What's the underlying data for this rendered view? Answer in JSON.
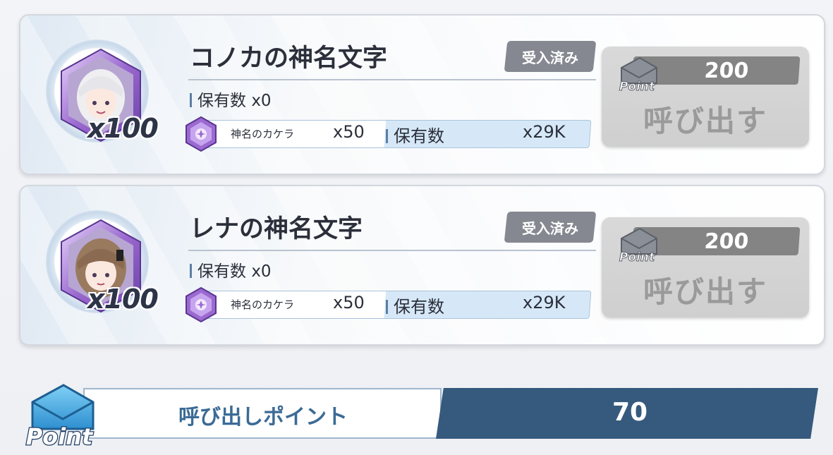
{
  "cards": [
    {
      "title": "コノカの神名文字",
      "badge": "受入済み",
      "quantity": "x100",
      "owned_label": "保有数",
      "owned_value": "x0",
      "material_name": "神名のカケラ",
      "material_cost": "x50",
      "stock_label": "保有数",
      "stock_value": "x29K",
      "point_cost": "200",
      "summon_label": "呼び出す",
      "point_icon_text": "Point"
    },
    {
      "title": "レナの神名文字",
      "badge": "受入済み",
      "quantity": "x100",
      "owned_label": "保有数",
      "owned_value": "x0",
      "material_name": "神名のカケラ",
      "material_cost": "x50",
      "stock_label": "保有数",
      "stock_value": "x29K",
      "point_cost": "200",
      "summon_label": "呼び出す",
      "point_icon_text": "Point"
    }
  ],
  "footer": {
    "label": "呼び出しポイント",
    "value": "70",
    "icon_text": "Point"
  },
  "colors": {
    "accent_dark": "#365a7d",
    "badge_gray": "#858890",
    "gem_purple": "#9b6ad0"
  }
}
